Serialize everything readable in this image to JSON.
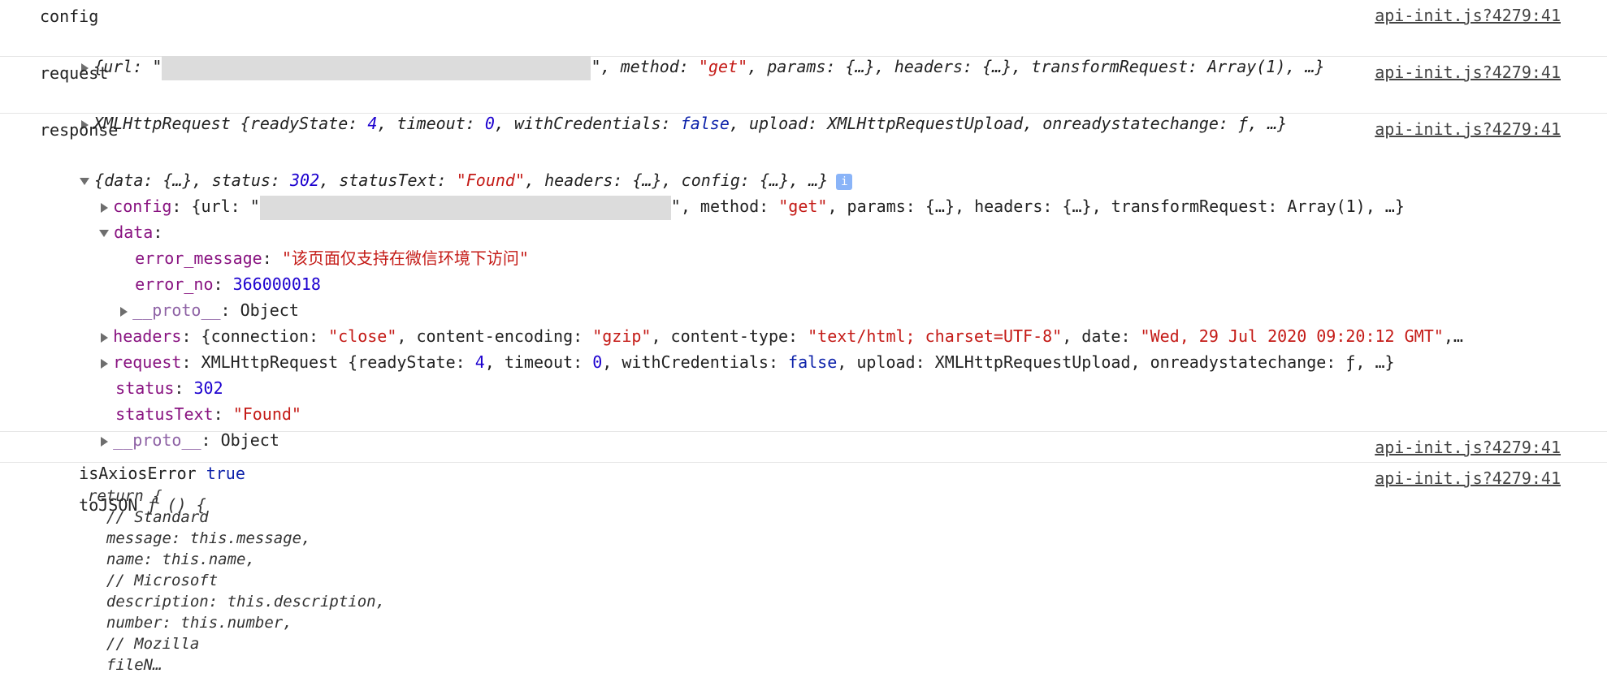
{
  "source_link": "api-init.js?4279:41",
  "config": {
    "label": "config",
    "summary_prefix": "{url: \"",
    "summary_mid": "\", method: ",
    "method_val": "\"get\"",
    "summary_rest": ", params: {…}, headers: {…}, transformRequest: Array(1), …}"
  },
  "request": {
    "label": "request",
    "p1": "XMLHttpRequest {readyState: ",
    "ready": "4",
    "p2": ", timeout: ",
    "timeout": "0",
    "p3": ", withCredentials: ",
    "wc": "false",
    "p4": ", upload: XMLHttpRequestUpload, onreadystatechange: ƒ, …}"
  },
  "response": {
    "label": "response",
    "summary": {
      "a": "{data: {…}, status: ",
      "status": "302",
      "b": ", statusText: ",
      "statusText": "\"Found\"",
      "c": ", headers: {…}, config: {…}, …}",
      "info": "i"
    },
    "config_line": {
      "key": "config",
      "a": ": {url: \"",
      "b": "\", method: ",
      "method": "\"get\"",
      "c": ", params: {…}, headers: {…}, transformRequest: Array(1), …}"
    },
    "data_key": "data",
    "error_message_key": "error_message",
    "error_message_val": "\"该页面仅支持在微信环境下访问\"",
    "error_no_key": "error_no",
    "error_no_val": "366000018",
    "proto_key": "__proto__",
    "proto_val": "Object",
    "headers": {
      "key": "headers",
      "a": ": {connection: ",
      "connection": "\"close\"",
      "b": ", content-encoding: ",
      "encoding": "\"gzip\"",
      "c": ", content-type: ",
      "ctype": "\"text/html; charset=UTF-8\"",
      "d": ", date: ",
      "date": "\"Wed, 29 Jul 2020 09:20:12 GMT\"",
      "e": ",…"
    },
    "request_line": {
      "key": "request",
      "a": ": XMLHttpRequest {readyState: ",
      "ready": "4",
      "b": ", timeout: ",
      "timeout": "0",
      "c": ", withCredentials: ",
      "wc": "false",
      "d": ", upload: XMLHttpRequestUpload, onreadystatechange: ƒ, …}"
    },
    "status_key": "status",
    "status_val": "302",
    "statusText_key": "statusText",
    "statusText_val": "\"Found\""
  },
  "isAxiosError": {
    "label": "isAxiosError",
    "value": "true"
  },
  "toJSON": {
    "label": "toJSON",
    "head": "ƒ () {",
    "lines": [
      "return {",
      "  // Standard",
      "  message: this.message,",
      "  name: this.name,",
      "  // Microsoft",
      "  description: this.description,",
      "  number: this.number,",
      "  // Mozilla",
      "  fileN…"
    ]
  }
}
